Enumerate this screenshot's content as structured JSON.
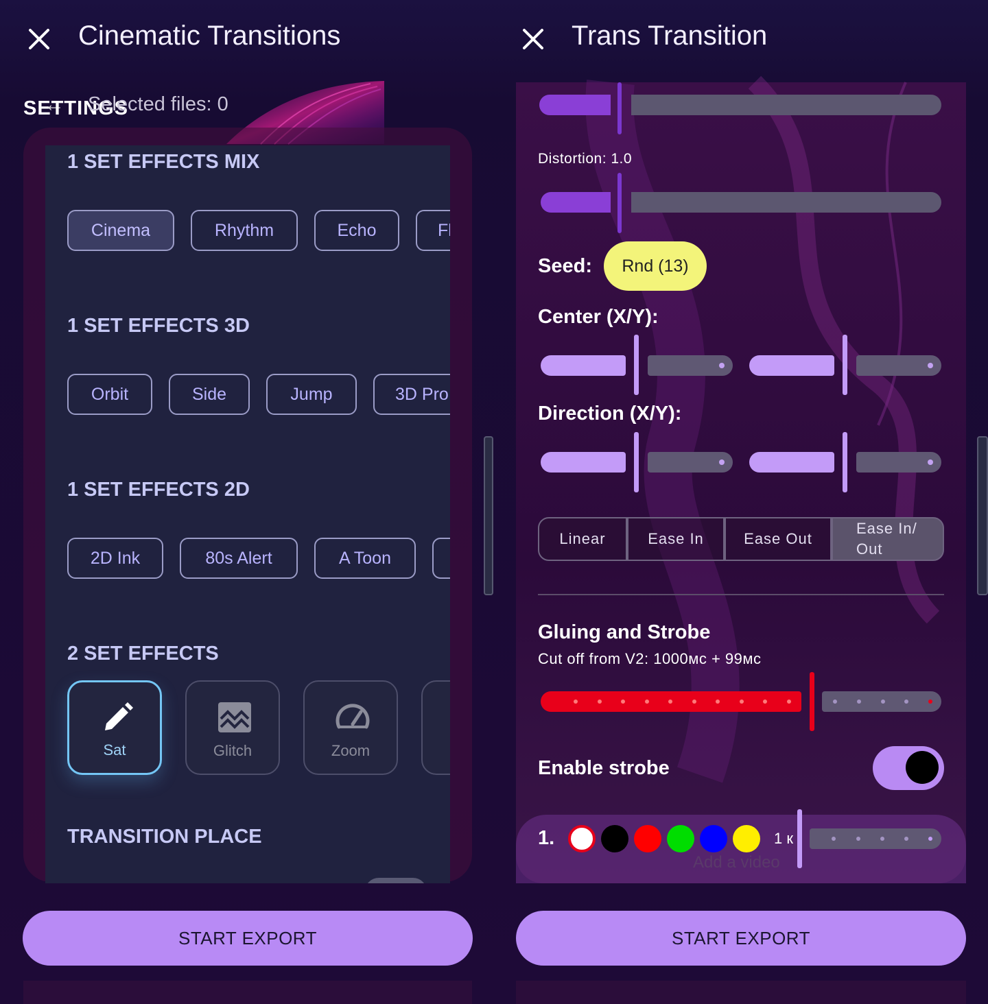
{
  "left": {
    "title": "Cinematic Transitions",
    "settings_label": "SETTINGS",
    "back_glyph": "←",
    "selected_files": "Selected files: 0",
    "sections": {
      "mix": {
        "title": "1 SET EFFECTS MIX",
        "chips": [
          "Cinema",
          "Rhythm",
          "Echo",
          "Fl"
        ],
        "selected": "Cinema"
      },
      "three_d": {
        "title": "1 SET EFFECTS 3D",
        "chips": [
          "Orbit",
          "Side",
          "Jump",
          "3D Pro"
        ]
      },
      "two_d": {
        "title": "1 SET EFFECTS 2D",
        "chips": [
          "2D Ink",
          "80s Alert",
          "A Toon",
          ""
        ]
      },
      "two_set": {
        "title": "2 SET EFFECTS",
        "tiles": [
          {
            "label": "Sat",
            "icon": "pencil-icon",
            "active": true
          },
          {
            "label": "Glitch",
            "icon": "glitch-image-icon",
            "active": false
          },
          {
            "label": "Zoom",
            "icon": "speedometer-icon",
            "active": false
          }
        ]
      },
      "place": {
        "title": "TRANSITION PLACE"
      }
    },
    "export_label": "START EXPORT"
  },
  "right": {
    "title": "Trans Transition",
    "distortion_label": "Distortion: 1.0",
    "distortion_value": 1.0,
    "seed_label": "Seed:",
    "seed_button": "Rnd (13)",
    "center_label": "Center (X/Y):",
    "direction_label": "Direction (X/Y):",
    "easing": {
      "options": [
        "Linear",
        "Ease In",
        "Ease Out",
        "Ease In/\nOut"
      ],
      "selected": "Ease In/\nOut"
    },
    "gluing_title": "Gluing and Strobe",
    "cut_off_text": "Cut off from V2: 1000мс + 99мс",
    "strobe_label": "Enable strobe",
    "strobe_enabled": true,
    "strobe_index": "1.",
    "strobe_colors": [
      "#ffffff",
      "#000000",
      "#ff0000",
      "#00dd00",
      "#0000ff",
      "#ffee00"
    ],
    "strobe_frames_label": "1 к",
    "add_video": "Add a video",
    "export_label": "START EXPORT"
  },
  "colors": {
    "accent": "#b88af5",
    "seed_button_bg": "#f3f47a",
    "cut_track": "#e8001a",
    "background": "#1a0f3d"
  }
}
